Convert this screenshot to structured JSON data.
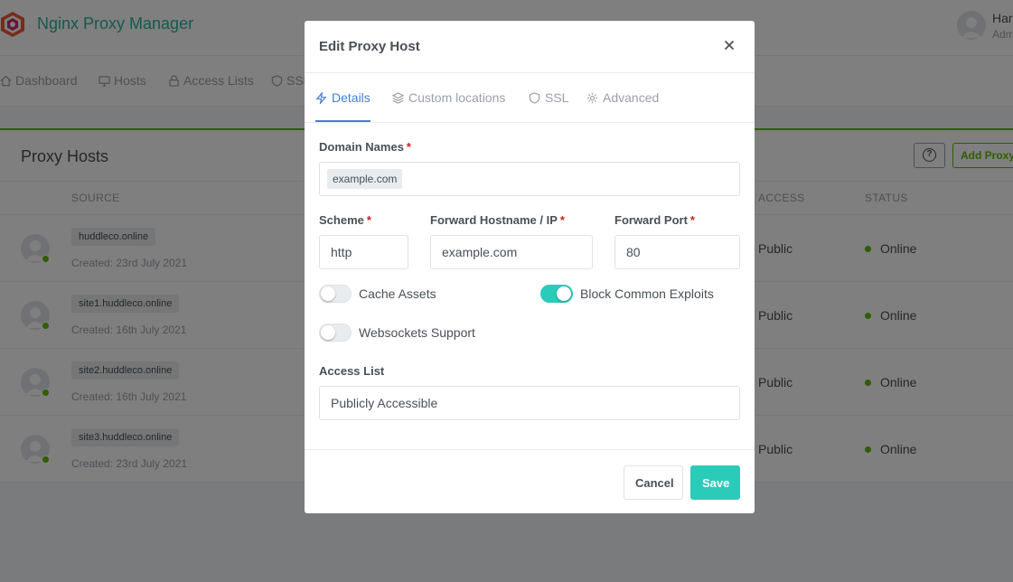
{
  "app": {
    "title": "Nginx Proxy Manager"
  },
  "user": {
    "name": "Har",
    "role": "Adm"
  },
  "nav": [
    {
      "label": "Dashboard",
      "icon": "home-icon"
    },
    {
      "label": "Hosts",
      "icon": "monitor-icon"
    },
    {
      "label": "Access Lists",
      "icon": "lock-icon"
    },
    {
      "label": "SSL",
      "icon": "shield-icon"
    }
  ],
  "page": {
    "title": "Proxy Hosts",
    "add_label": "Add Proxy Host",
    "help_label": "?",
    "columns": {
      "source": "SOURCE",
      "access": "ACCESS",
      "status": "STATUS"
    },
    "rows": [
      {
        "domain": "huddleco.online",
        "created": "Created: 23rd July 2021",
        "access": "Public",
        "status": "Online"
      },
      {
        "domain": "site1.huddleco.online",
        "created": "Created: 16th July 2021",
        "access": "Public",
        "status": "Online"
      },
      {
        "domain": "site2.huddleco.online",
        "created": "Created: 16th July 2021",
        "access": "Public",
        "status": "Online"
      },
      {
        "domain": "site3.huddleco.online",
        "created": "Created: 23rd July 2021",
        "access": "Public",
        "status": "Online"
      }
    ]
  },
  "modal": {
    "title": "Edit Proxy Host",
    "tabs": [
      {
        "label": "Details",
        "icon": "zap-icon",
        "active": true
      },
      {
        "label": "Custom locations",
        "icon": "layers-icon"
      },
      {
        "label": "SSL",
        "icon": "shield-icon"
      },
      {
        "label": "Advanced",
        "icon": "gear-icon"
      }
    ],
    "domain_names": {
      "label": "Domain Names",
      "required": "*",
      "value": "example.com"
    },
    "scheme": {
      "label": "Scheme",
      "required": "*",
      "value": "http"
    },
    "forward_host": {
      "label": "Forward Hostname / IP",
      "required": "*",
      "value": "example.com"
    },
    "forward_port": {
      "label": "Forward Port",
      "required": "*",
      "value": "80"
    },
    "toggles": {
      "cache_assets": {
        "label": "Cache Assets",
        "on": false
      },
      "block_exploits": {
        "label": "Block Common Exploits",
        "on": true
      },
      "websockets": {
        "label": "Websockets Support",
        "on": false
      }
    },
    "access_list": {
      "label": "Access List",
      "value": "Publicly Accessible"
    },
    "buttons": {
      "cancel": "Cancel",
      "save": "Save"
    }
  },
  "colors": {
    "brand": "#26b5a0",
    "accent": "#2bcbba",
    "success": "#5eba00",
    "link": "#467fcf",
    "required": "#cd201f"
  }
}
